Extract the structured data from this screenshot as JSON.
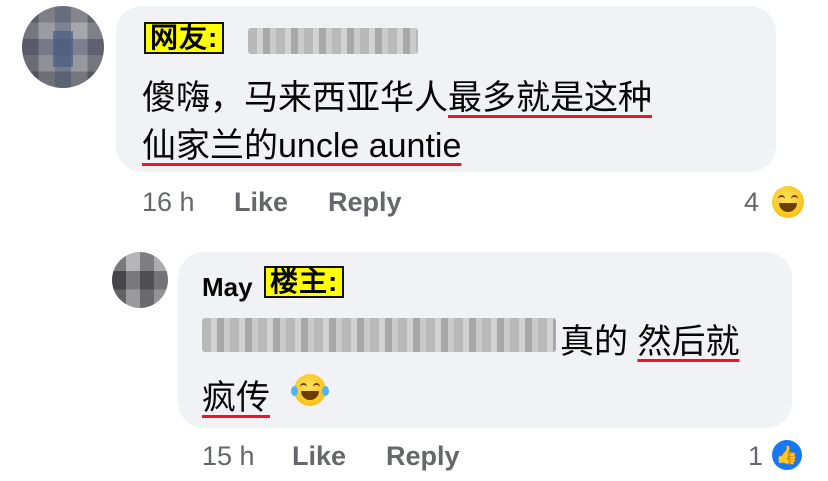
{
  "comment1": {
    "tag": "网友:",
    "line1_a": "傻嗨，马来西亚华人",
    "line1_b": "最多就是这种",
    "line2_a": "仙家兰的",
    "line2_b": "uncle auntie",
    "time": "16 h",
    "like": "Like",
    "reply": "Reply",
    "reaction_count": "4",
    "reaction_icon": "laughing-emoji"
  },
  "comment2": {
    "name": "May",
    "tag": "楼主:",
    "text_a": "真的",
    "text_b": "然后就",
    "text_c": "疯传",
    "time": "15 h",
    "like": "Like",
    "reply": "Reply",
    "reaction_count": "1",
    "reaction_icon": "like-icon",
    "inline_emoji": "tears-of-joy-emoji"
  },
  "colors": {
    "bubble": "#f0f2f5",
    "highlight": "#ffff00",
    "underline": "#e0192b",
    "meta": "#65676b",
    "like_blue": "#1877f2"
  }
}
